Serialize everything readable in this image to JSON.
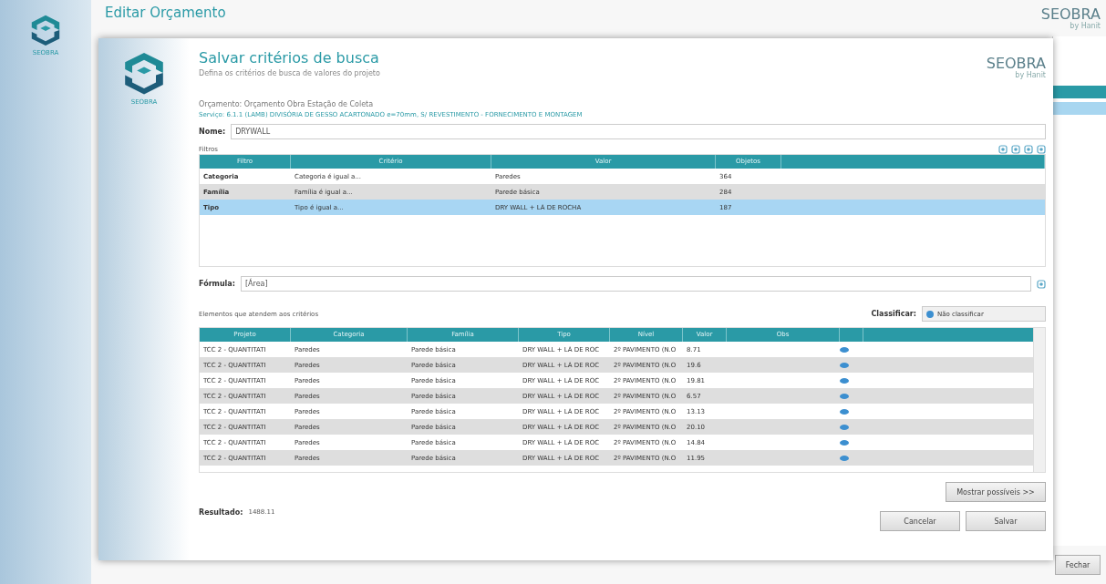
{
  "app": {
    "title": "Editar Orçamento",
    "sidebar_logo": "SEOBRA",
    "brand": "SEOBRA",
    "brand_sub": "by Hanit",
    "close_button": "Fechar"
  },
  "dialog": {
    "title": "Salvar critérios de busca",
    "subtitle": "Defina os critérios de busca de valores do projeto",
    "logo_text": "SEOBRA",
    "brand": "SEOBRA",
    "brand_sub": "by Hanit",
    "budget": "Orçamento: Orçamento Obra Estação de Coleta",
    "service": "Serviço: 6.1.1 (LAMB) DIVISÓRIA DE GESSO ACARTONADO e=70mm, S/ REVESTIMENTO - FORNECIMENTO E MONTAGEM",
    "name_label": "Nome:",
    "name_value": "DRYWALL",
    "filters_label": "Filtros",
    "filter_columns": [
      "Filtro",
      "Critério",
      "Valor",
      "Objetos"
    ],
    "filters": [
      {
        "filter": "Categoria",
        "criterion": "Categoria é igual a...",
        "value": "Paredes",
        "objects": "364",
        "selected": false
      },
      {
        "filter": "Família",
        "criterion": "Família é igual a...",
        "value": "Parede básica",
        "objects": "284",
        "selected": false
      },
      {
        "filter": "Tipo",
        "criterion": "Tipo é igual a...",
        "value": "DRY WALL + LÃ DE ROCHA",
        "objects": "187",
        "selected": true
      }
    ],
    "formula_label": "Fórmula:",
    "formula_value": "[Área]",
    "elements_label": "Elementos que atendem aos critérios",
    "sort_label": "Classificar:",
    "sort_value": "Não classificar",
    "element_columns": [
      "Projeto",
      "Categoria",
      "Família",
      "Tipo",
      "Nível",
      "Valor",
      "Obs"
    ],
    "elements": [
      {
        "project": "TCC 2 - QUANTITATI",
        "category": "Paredes",
        "family": "Parede básica",
        "type": "DRY WALL + LÃ DE ROC",
        "level": "2º PAVIMENTO (N.O",
        "value": "8.71"
      },
      {
        "project": "TCC 2 - QUANTITATI",
        "category": "Paredes",
        "family": "Parede básica",
        "type": "DRY WALL + LÃ DE ROC",
        "level": "2º PAVIMENTO (N.O",
        "value": "19.6"
      },
      {
        "project": "TCC 2 - QUANTITATI",
        "category": "Paredes",
        "family": "Parede básica",
        "type": "DRY WALL + LÃ DE ROC",
        "level": "2º PAVIMENTO (N.O",
        "value": "19.81"
      },
      {
        "project": "TCC 2 - QUANTITATI",
        "category": "Paredes",
        "family": "Parede básica",
        "type": "DRY WALL + LÃ DE ROC",
        "level": "2º PAVIMENTO (N.O",
        "value": "6.57"
      },
      {
        "project": "TCC 2 - QUANTITATI",
        "category": "Paredes",
        "family": "Parede básica",
        "type": "DRY WALL + LÃ DE ROC",
        "level": "2º PAVIMENTO (N.O",
        "value": "13.13"
      },
      {
        "project": "TCC 2 - QUANTITATI",
        "category": "Paredes",
        "family": "Parede básica",
        "type": "DRY WALL + LÃ DE ROC",
        "level": "2º PAVIMENTO (N.O",
        "value": "20.10"
      },
      {
        "project": "TCC 2 - QUANTITATI",
        "category": "Paredes",
        "family": "Parede básica",
        "type": "DRY WALL + LÃ DE ROC",
        "level": "2º PAVIMENTO (N.O",
        "value": "14.84"
      },
      {
        "project": "TCC 2 - QUANTITATI",
        "category": "Paredes",
        "family": "Parede básica",
        "type": "DRY WALL + LÃ DE ROC",
        "level": "2º PAVIMENTO (N.O",
        "value": "11.95"
      }
    ],
    "result_label": "Resultado:",
    "result_value": "1488.11",
    "more_button": "Mostrar possíveis >>",
    "cancel_button": "Cancelar",
    "save_button": "Salvar"
  }
}
